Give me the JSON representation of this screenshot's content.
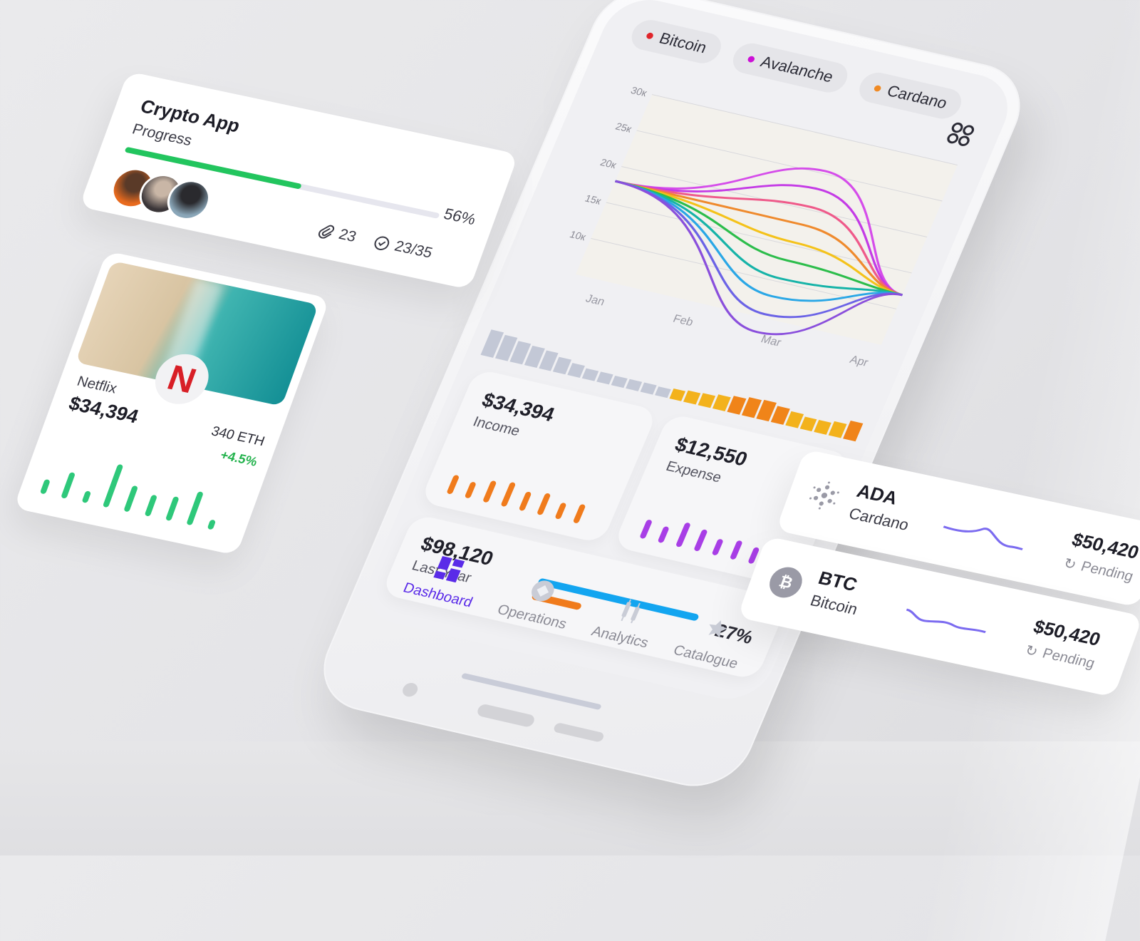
{
  "legend": [
    {
      "label": "Bitcoin",
      "color": "#e0242a"
    },
    {
      "label": "Avalanche",
      "color": "#cc10d6"
    },
    {
      "label": "Cardano",
      "color": "#f08a24"
    }
  ],
  "chart": {
    "y_ticks": [
      "30к",
      "25к",
      "20к",
      "15к",
      "10к"
    ],
    "x_ticks": [
      "Jan",
      "Feb",
      "Mar",
      "Apr"
    ],
    "colors": [
      "#d54dea",
      "#c43be6",
      "#ef5a8a",
      "#ef8a2d",
      "#f4c21a",
      "#2cbd4b",
      "#16b3a8",
      "#2aa7e6",
      "#6b63e6",
      "#8a4fdc"
    ]
  },
  "mini_bars": {
    "levels": [
      0.55,
      0.5,
      0.45,
      0.42,
      0.38,
      0.32,
      0.26,
      0.22,
      0.22,
      0.2,
      0.2,
      0.2,
      0.18,
      0.22,
      0.24,
      0.26,
      0.3,
      0.34,
      0.38,
      0.4,
      0.34,
      0.3,
      0.26,
      0.26,
      0.3,
      0.38
    ],
    "gray_count": 13,
    "gray_color": "#c3c8d6",
    "gold_color": "#f3b21c",
    "orange_color": "#f08419"
  },
  "income": {
    "amount": "$34,394",
    "label": "Income",
    "color": "#f07b1c"
  },
  "expense": {
    "amount": "$12,550",
    "label": "Expense",
    "color": "#a83ee6"
  },
  "last_year": {
    "amount": "$98,120",
    "label": "Last Year",
    "percent": "27%",
    "progress": 0.27,
    "bar_color": "#13a5f0",
    "accent_color": "#f07b1c"
  },
  "nav": [
    {
      "label": "Dashboard",
      "icon": "grid-icon",
      "active": true
    },
    {
      "label": "Operations",
      "icon": "operations-icon",
      "active": false
    },
    {
      "label": "Analytics",
      "icon": "candles-icon",
      "active": false
    },
    {
      "label": "Catalogue",
      "icon": "catalogue-icon",
      "active": false
    }
  ],
  "crypto_app": {
    "title": "Crypto App",
    "subtitle": "Progress",
    "progress": 0.56,
    "percent": "56%",
    "attachments": "23",
    "tasks": "23/35",
    "bar_color": "#22c55e"
  },
  "netflix": {
    "name": "Netflix",
    "amount": "$34,394",
    "eth": "340 ETH",
    "change": "+4.5%",
    "logo_letter": "N",
    "bar_color": "#2ec87a",
    "bars": [
      0.3,
      0.55,
      0.25,
      0.9,
      0.55,
      0.45,
      0.5,
      0.7,
      0.2
    ]
  },
  "ada": {
    "symbol": "ADA",
    "name": "Cardano",
    "price": "$50,420",
    "status": "Pending"
  },
  "btc": {
    "symbol": "BTC",
    "name": "Bitcoin",
    "price": "$50,420",
    "status": "Pending",
    "coin_glyph": "₿"
  }
}
